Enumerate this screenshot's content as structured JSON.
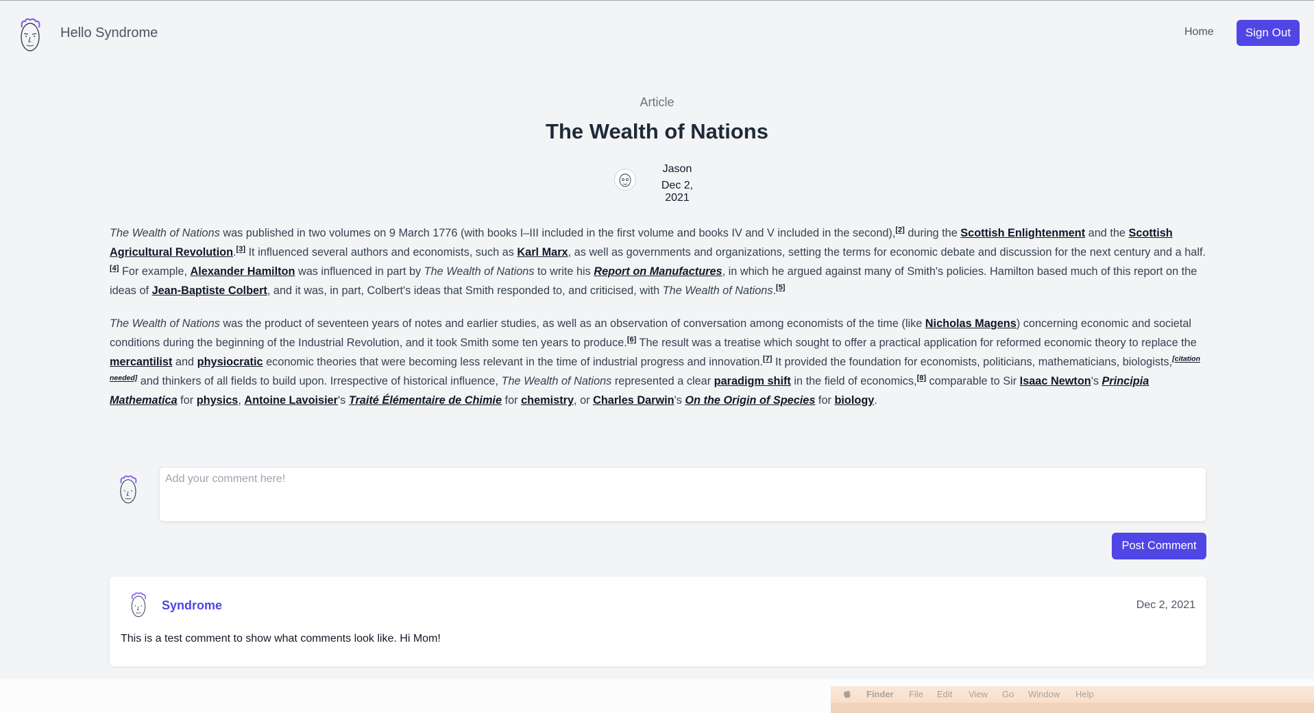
{
  "header": {
    "site_name": "Hello Syndrome",
    "nav_home": "Home",
    "sign_out": "Sign Out"
  },
  "article": {
    "kicker": "Article",
    "title": "The Wealth of Nations",
    "author": "Jason",
    "date": "Dec 2, 2021"
  },
  "body": {
    "p1": {
      "t_wealth": "The Wealth of Nations",
      "t1": " was published in two volumes on 9 March 1776 (with books I–III included in the first volume and books IV and V included in the second),",
      "ref2": "[2]",
      "t2": " during the ",
      "link_scottish_enlightenment": "Scottish Enlightenment",
      "t3": " and the ",
      "link_scottish_agri": "Scottish Agricultural Revolution",
      "t4": ".",
      "ref3": "[3]",
      "t5": " It influenced several authors and economists, such as ",
      "link_marx": "Karl Marx",
      "t6": ", as well as governments and organizations, setting the terms for economic debate and discussion for the next century and a half.",
      "ref4": "[4]",
      "t7": " For example, ",
      "link_hamilton": "Alexander Hamilton",
      "t8": " was influenced in part by ",
      "t_wealth2": "The Wealth of Nations",
      "t9": " to write his ",
      "link_report": "Report on Manufactures",
      "t10": ", in which he argued against many of Smith's policies. Hamilton based much of this report on the ideas of ",
      "link_colbert": "Jean-Baptiste Colbert",
      "t11": ", and it was, in part, Colbert's ideas that Smith responded to, and criticised, with ",
      "t_wealth3": "The Wealth of Nations",
      "t12": ".",
      "ref5": "[5]"
    },
    "p2": {
      "t_wealth": "The Wealth of Nations",
      "t1": " was the product of seventeen years of notes and earlier studies, as well as an observation of conversation among economists of the time (like ",
      "link_magens": "Nicholas Magens",
      "t2": ") concerning economic and societal conditions during the beginning of the Industrial Revolution, and it took Smith some ten years to produce.",
      "ref6": "[6]",
      "t3": " The result was a treatise which sought to offer a practical application for reformed economic theory to replace the ",
      "link_mercantilist": "mercantilist",
      "t4": " and ",
      "link_physiocratic": "physiocratic",
      "t5": " economic theories that were becoming less relevant in the time of industrial progress and innovation.",
      "ref7": "[7]",
      "t6": " It provided the foundation for economists, politicians, mathematicians, biologists,",
      "cn": "[citation needed]",
      "t7": " and thinkers of all fields to build upon. Irrespective of historical influence, ",
      "t_wealth2": "The Wealth of Nations",
      "t8": " represented a clear ",
      "link_paradigm": "paradigm shift",
      "t9": " in the field of economics,",
      "ref8": "[8]",
      "t10": " comparable to Sir ",
      "link_newton": "Isaac Newton",
      "t11": "'s ",
      "link_principia": "Principia Mathematica",
      "t12": " for ",
      "link_physics": "physics",
      "t13": ", ",
      "link_lavoisier": "Antoine Lavoisier",
      "t14": "'s ",
      "link_traite": "Traité Élémentaire de Chimie",
      "t15": " for ",
      "link_chemistry": "chemistry",
      "t16": ", or ",
      "link_darwin": "Charles Darwin",
      "t17": "'s ",
      "link_origin": "On the Origin of Species",
      "t18": " for ",
      "link_biology": "biology",
      "t19": "."
    }
  },
  "comment_form": {
    "placeholder": "Add your comment here!",
    "value": "",
    "post_label": "Post Comment"
  },
  "comments": [
    {
      "author": "Syndrome",
      "date": "Dec 2, 2021",
      "text": "This is a test comment to show what comments look like. Hi Mom!"
    }
  ],
  "os_menubar": {
    "apple": "",
    "app": "Finder",
    "items": [
      "File",
      "Edit",
      "View",
      "Go",
      "Window",
      "Help"
    ]
  },
  "colors": {
    "accent": "#4f46e5",
    "background": "#f3f4f6",
    "text": "#374151"
  },
  "icons": {
    "logo": "syndrome-face-icon",
    "author_avatar": "avatar-face-icon",
    "apple": "apple-icon"
  }
}
